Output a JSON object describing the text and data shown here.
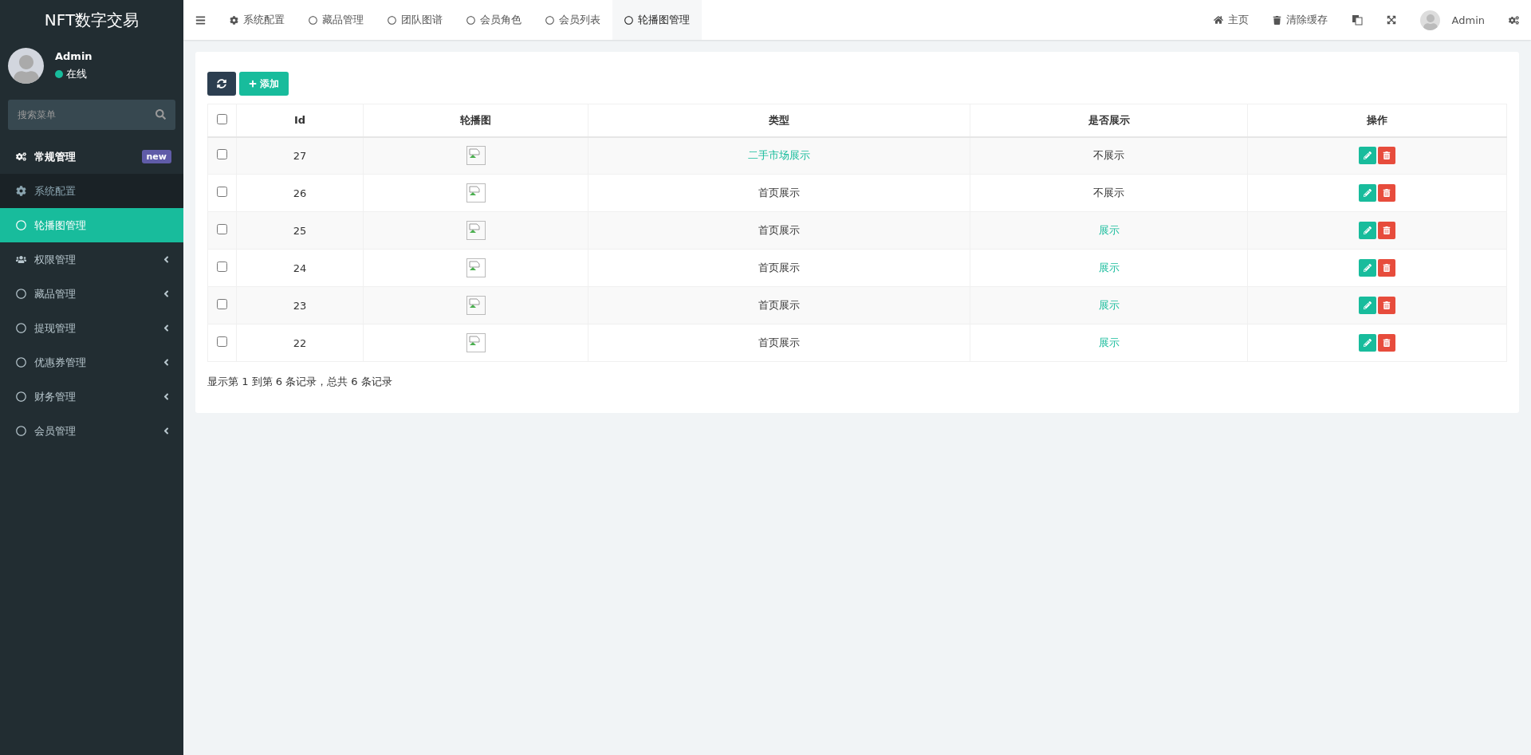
{
  "brand": "NFT数字交易",
  "user": {
    "name": "Admin",
    "status": "在线",
    "online": true
  },
  "sidebar": {
    "search": {
      "placeholder": "搜索菜单"
    },
    "items": [
      {
        "label": "常规管理",
        "badge": "new",
        "expanded": true,
        "children": [
          {
            "label": "系统配置",
            "selected": false
          },
          {
            "label": "轮播图管理",
            "selected": true
          }
        ]
      },
      {
        "label": "权限管理",
        "expanded": false
      },
      {
        "label": "藏品管理",
        "expanded": false
      },
      {
        "label": "提现管理",
        "expanded": false
      },
      {
        "label": "优惠券管理",
        "expanded": false
      },
      {
        "label": "财务管理",
        "expanded": false
      },
      {
        "label": "会员管理",
        "expanded": false
      }
    ]
  },
  "tabs": [
    {
      "label": "系统配置",
      "selected": false
    },
    {
      "label": "藏品管理",
      "selected": false
    },
    {
      "label": "团队图谱",
      "selected": false
    },
    {
      "label": "会员角色",
      "selected": false
    },
    {
      "label": "会员列表",
      "selected": false
    },
    {
      "label": "轮播图管理",
      "selected": true
    }
  ],
  "header_links": [
    {
      "label": "主页"
    },
    {
      "label": "清除缓存"
    }
  ],
  "header_user": "Admin",
  "toolbar": {
    "add_label": "添加"
  },
  "table": {
    "columns": [
      "Id",
      "轮播图",
      "类型",
      "是否展示",
      "操作"
    ],
    "all_checked": false,
    "rows": [
      {
        "id": "27",
        "checked": false,
        "type": {
          "label": "二手市场展示",
          "kind": "market"
        },
        "shown": false,
        "display": "不展示"
      },
      {
        "id": "26",
        "checked": false,
        "type": {
          "label": "首页展示",
          "kind": "home"
        },
        "shown": false,
        "display": "不展示"
      },
      {
        "id": "25",
        "checked": false,
        "type": {
          "label": "首页展示",
          "kind": "home"
        },
        "shown": true,
        "display": "展示"
      },
      {
        "id": "24",
        "checked": false,
        "type": {
          "label": "首页展示",
          "kind": "home"
        },
        "shown": true,
        "display": "展示"
      },
      {
        "id": "23",
        "checked": false,
        "type": {
          "label": "首页展示",
          "kind": "home"
        },
        "shown": true,
        "display": "展示"
      },
      {
        "id": "22",
        "checked": false,
        "type": {
          "label": "首页展示",
          "kind": "home"
        },
        "shown": true,
        "display": "展示"
      }
    ]
  },
  "pagination_info": "显示第 1 到第 6 条记录，总共 6 条记录"
}
